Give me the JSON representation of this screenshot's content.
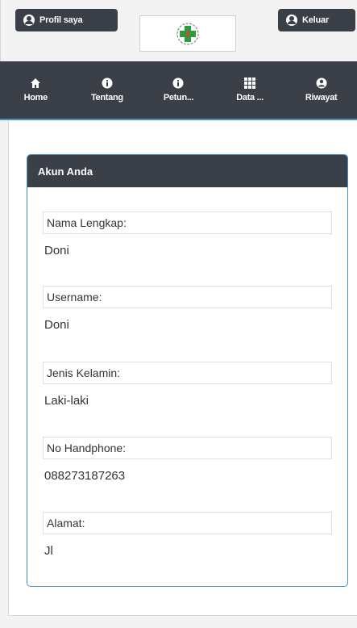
{
  "header": {
    "profile_label": "Profil saya",
    "logout_label": "Keluar"
  },
  "nav": [
    {
      "label": "Home",
      "icon": "home-icon"
    },
    {
      "label": "Tentang",
      "icon": "info-icon"
    },
    {
      "label": "Petun...",
      "icon": "info-icon"
    },
    {
      "label": "Data ...",
      "icon": "grid-icon"
    },
    {
      "label": "Riwayat",
      "icon": "user-icon"
    }
  ],
  "panel": {
    "title": "Akun Anda",
    "fields": [
      {
        "label": "Nama Lengkap:",
        "value": "Doni"
      },
      {
        "label": "Username:",
        "value": "Doni"
      },
      {
        "label": "Jenis Kelamin:",
        "value": "Laki-laki"
      },
      {
        "label": "No Handphone:",
        "value": "088273187263"
      },
      {
        "label": "Alamat:",
        "value": "Jl"
      }
    ]
  },
  "colors": {
    "dark": "#3b3f48",
    "accent": "#4a90c8",
    "logo_green": "#2e9b3a"
  }
}
